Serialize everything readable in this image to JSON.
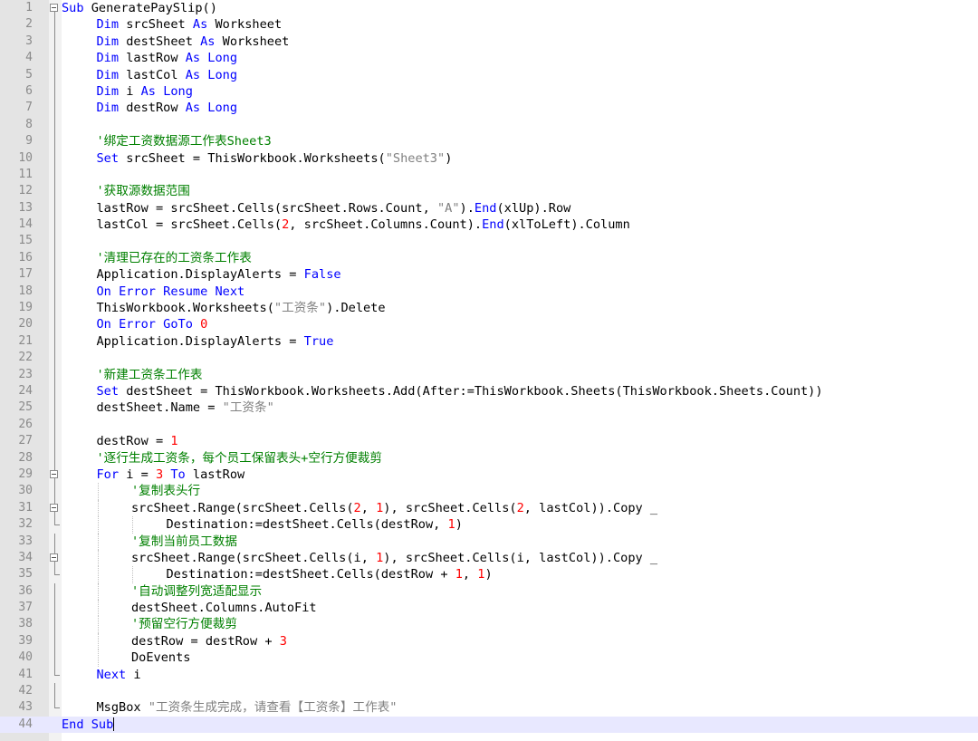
{
  "editor": {
    "language": "vb",
    "current_line": 44,
    "lines": [
      {
        "n": "1",
        "indent": 0,
        "tokens": [
          {
            "t": "kw",
            "v": "Sub"
          },
          {
            "t": "p",
            "v": " GeneratePaySlip()"
          }
        ]
      },
      {
        "n": "2",
        "indent": 1,
        "tokens": [
          {
            "t": "kw",
            "v": "Dim"
          },
          {
            "t": "p",
            "v": " srcSheet "
          },
          {
            "t": "kw",
            "v": "As"
          },
          {
            "t": "p",
            "v": " Worksheet"
          }
        ]
      },
      {
        "n": "3",
        "indent": 1,
        "tokens": [
          {
            "t": "kw",
            "v": "Dim"
          },
          {
            "t": "p",
            "v": " destSheet "
          },
          {
            "t": "kw",
            "v": "As"
          },
          {
            "t": "p",
            "v": " Worksheet"
          }
        ]
      },
      {
        "n": "4",
        "indent": 1,
        "tokens": [
          {
            "t": "kw",
            "v": "Dim"
          },
          {
            "t": "p",
            "v": " lastRow "
          },
          {
            "t": "kw",
            "v": "As"
          },
          {
            "t": "p",
            "v": " "
          },
          {
            "t": "kw",
            "v": "Long"
          }
        ]
      },
      {
        "n": "5",
        "indent": 1,
        "tokens": [
          {
            "t": "kw",
            "v": "Dim"
          },
          {
            "t": "p",
            "v": " lastCol "
          },
          {
            "t": "kw",
            "v": "As"
          },
          {
            "t": "p",
            "v": " "
          },
          {
            "t": "kw",
            "v": "Long"
          }
        ]
      },
      {
        "n": "6",
        "indent": 1,
        "tokens": [
          {
            "t": "kw",
            "v": "Dim"
          },
          {
            "t": "p",
            "v": " i "
          },
          {
            "t": "kw",
            "v": "As"
          },
          {
            "t": "p",
            "v": " "
          },
          {
            "t": "kw",
            "v": "Long"
          }
        ]
      },
      {
        "n": "7",
        "indent": 1,
        "tokens": [
          {
            "t": "kw",
            "v": "Dim"
          },
          {
            "t": "p",
            "v": " destRow "
          },
          {
            "t": "kw",
            "v": "As"
          },
          {
            "t": "p",
            "v": " "
          },
          {
            "t": "kw",
            "v": "Long"
          }
        ]
      },
      {
        "n": "8",
        "indent": 0,
        "tokens": []
      },
      {
        "n": "9",
        "indent": 1,
        "tokens": [
          {
            "t": "cmt",
            "v": "'绑定工资数据源工作表Sheet3"
          }
        ]
      },
      {
        "n": "10",
        "indent": 1,
        "tokens": [
          {
            "t": "kw",
            "v": "Set"
          },
          {
            "t": "p",
            "v": " srcSheet = ThisWorkbook.Worksheets("
          },
          {
            "t": "str",
            "v": "\"Sheet3\""
          },
          {
            "t": "p",
            "v": ")"
          }
        ]
      },
      {
        "n": "11",
        "indent": 0,
        "tokens": []
      },
      {
        "n": "12",
        "indent": 1,
        "tokens": [
          {
            "t": "cmt",
            "v": "'获取源数据范围"
          }
        ]
      },
      {
        "n": "13",
        "indent": 1,
        "tokens": [
          {
            "t": "p",
            "v": "lastRow = srcSheet.Cells(srcSheet.Rows.Count, "
          },
          {
            "t": "str",
            "v": "\"A\""
          },
          {
            "t": "p",
            "v": ")."
          },
          {
            "t": "kw",
            "v": "End"
          },
          {
            "t": "p",
            "v": "(xlUp).Row"
          }
        ]
      },
      {
        "n": "14",
        "indent": 1,
        "tokens": [
          {
            "t": "p",
            "v": "lastCol = srcSheet.Cells("
          },
          {
            "t": "num",
            "v": "2"
          },
          {
            "t": "p",
            "v": ", srcSheet.Columns.Count)."
          },
          {
            "t": "kw",
            "v": "End"
          },
          {
            "t": "p",
            "v": "(xlToLeft).Column"
          }
        ]
      },
      {
        "n": "15",
        "indent": 0,
        "tokens": []
      },
      {
        "n": "16",
        "indent": 1,
        "tokens": [
          {
            "t": "cmt",
            "v": "'清理已存在的工资条工作表"
          }
        ]
      },
      {
        "n": "17",
        "indent": 1,
        "tokens": [
          {
            "t": "p",
            "v": "Application.DisplayAlerts = "
          },
          {
            "t": "kw",
            "v": "False"
          }
        ]
      },
      {
        "n": "18",
        "indent": 1,
        "tokens": [
          {
            "t": "kw",
            "v": "On"
          },
          {
            "t": "p",
            "v": " "
          },
          {
            "t": "kw",
            "v": "Error"
          },
          {
            "t": "p",
            "v": " "
          },
          {
            "t": "kw",
            "v": "Resume"
          },
          {
            "t": "p",
            "v": " "
          },
          {
            "t": "kw",
            "v": "Next"
          }
        ]
      },
      {
        "n": "19",
        "indent": 1,
        "tokens": [
          {
            "t": "p",
            "v": "ThisWorkbook.Worksheets("
          },
          {
            "t": "str",
            "v": "\"工资条\""
          },
          {
            "t": "p",
            "v": ").Delete"
          }
        ]
      },
      {
        "n": "20",
        "indent": 1,
        "tokens": [
          {
            "t": "kw",
            "v": "On"
          },
          {
            "t": "p",
            "v": " "
          },
          {
            "t": "kw",
            "v": "Error"
          },
          {
            "t": "p",
            "v": " "
          },
          {
            "t": "kw",
            "v": "GoTo"
          },
          {
            "t": "p",
            "v": " "
          },
          {
            "t": "num",
            "v": "0"
          }
        ]
      },
      {
        "n": "21",
        "indent": 1,
        "tokens": [
          {
            "t": "p",
            "v": "Application.DisplayAlerts = "
          },
          {
            "t": "kw",
            "v": "True"
          }
        ]
      },
      {
        "n": "22",
        "indent": 0,
        "tokens": []
      },
      {
        "n": "23",
        "indent": 1,
        "tokens": [
          {
            "t": "cmt",
            "v": "'新建工资条工作表"
          }
        ]
      },
      {
        "n": "24",
        "indent": 1,
        "tokens": [
          {
            "t": "kw",
            "v": "Set"
          },
          {
            "t": "p",
            "v": " destSheet = ThisWorkbook.Worksheets.Add(After:=ThisWorkbook.Sheets(ThisWorkbook.Sheets.Count))"
          }
        ]
      },
      {
        "n": "25",
        "indent": 1,
        "tokens": [
          {
            "t": "p",
            "v": "destSheet.Name = "
          },
          {
            "t": "str",
            "v": "\"工资条\""
          }
        ]
      },
      {
        "n": "26",
        "indent": 0,
        "tokens": []
      },
      {
        "n": "27",
        "indent": 1,
        "tokens": [
          {
            "t": "p",
            "v": "destRow = "
          },
          {
            "t": "num",
            "v": "1"
          }
        ]
      },
      {
        "n": "28",
        "indent": 1,
        "tokens": [
          {
            "t": "cmt",
            "v": "'逐行生成工资条，每个员工保留表头+空行方便裁剪"
          }
        ]
      },
      {
        "n": "29",
        "indent": 1,
        "tokens": [
          {
            "t": "kw",
            "v": "For"
          },
          {
            "t": "p",
            "v": " i = "
          },
          {
            "t": "num",
            "v": "3"
          },
          {
            "t": "p",
            "v": " "
          },
          {
            "t": "kw",
            "v": "To"
          },
          {
            "t": "p",
            "v": " lastRow"
          }
        ]
      },
      {
        "n": "30",
        "indent": 2,
        "tokens": [
          {
            "t": "cmt",
            "v": "'复制表头行"
          }
        ]
      },
      {
        "n": "31",
        "indent": 2,
        "tokens": [
          {
            "t": "p",
            "v": "srcSheet.Range(srcSheet.Cells("
          },
          {
            "t": "num",
            "v": "2"
          },
          {
            "t": "p",
            "v": ", "
          },
          {
            "t": "num",
            "v": "1"
          },
          {
            "t": "p",
            "v": "), srcSheet.Cells("
          },
          {
            "t": "num",
            "v": "2"
          },
          {
            "t": "p",
            "v": ", lastCol)).Copy _"
          }
        ]
      },
      {
        "n": "32",
        "indent": 3,
        "tokens": [
          {
            "t": "p",
            "v": "Destination:=destSheet.Cells(destRow, "
          },
          {
            "t": "num",
            "v": "1"
          },
          {
            "t": "p",
            "v": ")"
          }
        ]
      },
      {
        "n": "33",
        "indent": 2,
        "tokens": [
          {
            "t": "cmt",
            "v": "'复制当前员工数据"
          }
        ]
      },
      {
        "n": "34",
        "indent": 2,
        "tokens": [
          {
            "t": "p",
            "v": "srcSheet.Range(srcSheet.Cells(i, "
          },
          {
            "t": "num",
            "v": "1"
          },
          {
            "t": "p",
            "v": "), srcSheet.Cells(i, lastCol)).Copy _"
          }
        ]
      },
      {
        "n": "35",
        "indent": 3,
        "tokens": [
          {
            "t": "p",
            "v": "Destination:=destSheet.Cells(destRow + "
          },
          {
            "t": "num",
            "v": "1"
          },
          {
            "t": "p",
            "v": ", "
          },
          {
            "t": "num",
            "v": "1"
          },
          {
            "t": "p",
            "v": ")"
          }
        ]
      },
      {
        "n": "36",
        "indent": 2,
        "tokens": [
          {
            "t": "cmt",
            "v": "'自动调整列宽适配显示"
          }
        ]
      },
      {
        "n": "37",
        "indent": 2,
        "tokens": [
          {
            "t": "p",
            "v": "destSheet.Columns.AutoFit"
          }
        ]
      },
      {
        "n": "38",
        "indent": 2,
        "tokens": [
          {
            "t": "cmt",
            "v": "'预留空行方便裁剪"
          }
        ]
      },
      {
        "n": "39",
        "indent": 2,
        "tokens": [
          {
            "t": "p",
            "v": "destRow = destRow + "
          },
          {
            "t": "num",
            "v": "3"
          }
        ]
      },
      {
        "n": "40",
        "indent": 2,
        "tokens": [
          {
            "t": "p",
            "v": "DoEvents"
          }
        ]
      },
      {
        "n": "41",
        "indent": 1,
        "tokens": [
          {
            "t": "kw",
            "v": "Next"
          },
          {
            "t": "p",
            "v": " i"
          }
        ]
      },
      {
        "n": "42",
        "indent": 0,
        "tokens": []
      },
      {
        "n": "43",
        "indent": 1,
        "tokens": [
          {
            "t": "p",
            "v": "MsgBox "
          },
          {
            "t": "str",
            "v": "\"工资条生成完成，请查看【工资条】工作表\""
          }
        ]
      },
      {
        "n": "44",
        "indent": 0,
        "tokens": [
          {
            "t": "kw",
            "v": "End"
          },
          {
            "t": "p",
            "v": " "
          },
          {
            "t": "kw",
            "v": "Sub"
          }
        ]
      }
    ]
  },
  "colors": {
    "keyword": "#0000ff",
    "number": "#ff0000",
    "string": "#808080",
    "comment": "#008000",
    "gutter": "#e4e4e4",
    "current_line": "#e8e8ff"
  }
}
